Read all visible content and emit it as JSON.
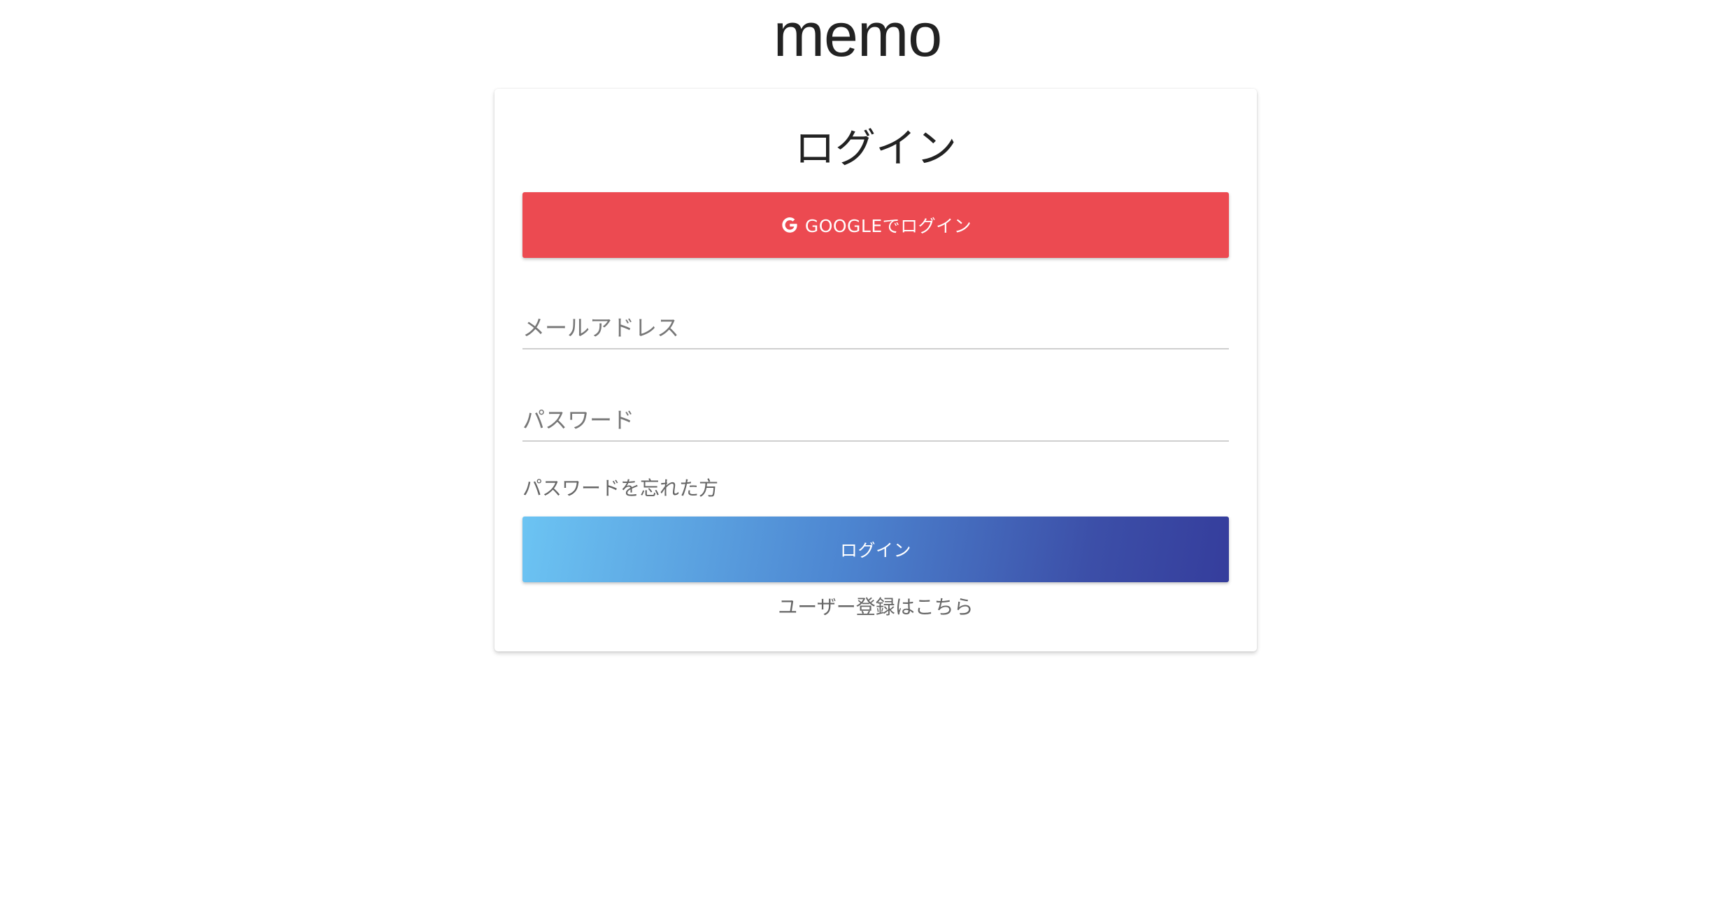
{
  "header": {
    "app_title": "memo"
  },
  "login_card": {
    "title": "ログイン",
    "google_button_label": "GOOGLEでログイン",
    "google_icon": "google-g-icon",
    "email_placeholder": "メールアドレス",
    "email_value": "",
    "password_placeholder": "パスワード",
    "password_value": "",
    "forgot_password_label": "パスワードを忘れた方",
    "login_button_label": "ログイン",
    "register_link_label": "ユーザー登録はこちら"
  },
  "colors": {
    "google_button": "#ec4a51",
    "login_gradient_start": "#6cc4f3",
    "login_gradient_end": "#353d9c",
    "text_primary": "#222222",
    "text_secondary": "#666666"
  }
}
